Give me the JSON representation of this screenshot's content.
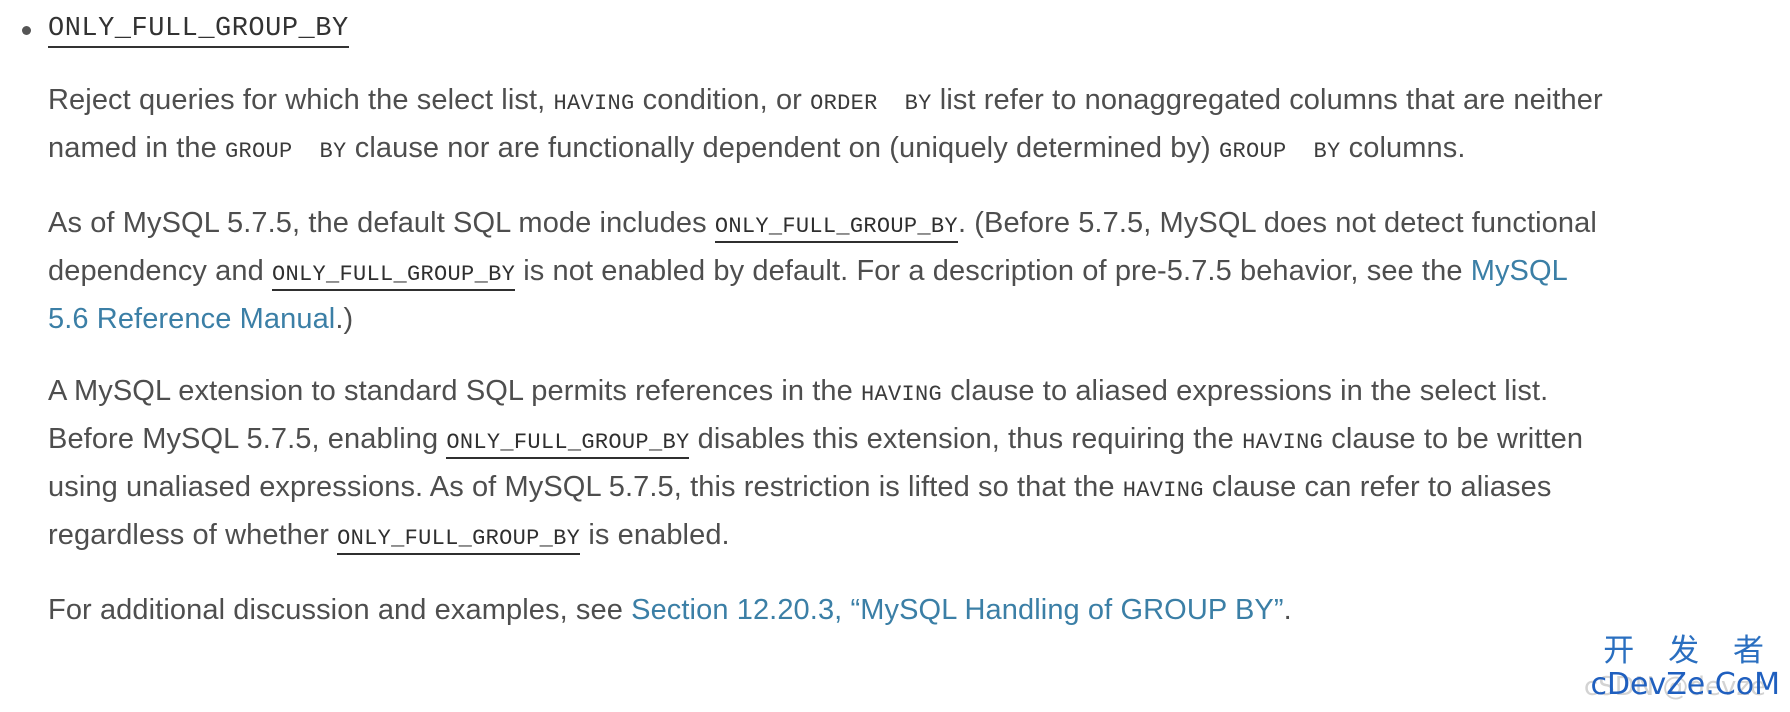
{
  "page": {
    "background_color": "#ffffff",
    "text_color": "#4e4e4e",
    "link_color": "#3b7fa6",
    "code_color": "#333333"
  },
  "heading": {
    "bullet_marker": "bullet-dot",
    "term": "ONLY_FULL_GROUP_BY"
  },
  "paragraphs": {
    "p1": {
      "s1": "Reject queries for which the select list, ",
      "code1": "HAVING",
      "s2": " condition, or ",
      "code2": "ORDER  BY",
      "s3": " list refer to nonaggregated columns that are neither named in the ",
      "code3": "GROUP  BY",
      "s4": " clause nor are functionally dependent on (uniquely determined by) ",
      "code4": "GROUP  BY",
      "s5": " columns."
    },
    "p2": {
      "s1": "As of MySQL 5.7.5, the default SQL mode includes ",
      "code1": "ONLY_FULL_GROUP_BY",
      "s2": ". (Before 5.7.5, MySQL does not detect functional dependency and ",
      "code2": "ONLY_FULL_GROUP_BY",
      "s3": " is not enabled by default. For a description of pre-5.7.5 behavior, see the ",
      "link1": "MySQL 5.6 Reference Manual",
      "s4": ".)"
    },
    "p3": {
      "s1": "A MySQL extension to standard SQL permits references in the ",
      "code1": "HAVING",
      "s2": " clause to aliased expressions in the select list. Before MySQL 5.7.5, enabling ",
      "code2": "ONLY_FULL_GROUP_BY",
      "s3": " disables this extension, thus requiring the ",
      "code3": "HAVING",
      "s4": " clause to be written using unaliased expressions. As of MySQL 5.7.5, this restriction is lifted so that the ",
      "code4": "HAVING",
      "s5": " clause can refer to aliases regardless of whether ",
      "code5": "ONLY_FULL_GROUP_BY",
      "s6": " is enabled."
    },
    "p4": {
      "s1": "For additional discussion and examples, see ",
      "link1": "Section 12.20.3, “MySQL Handling of GROUP BY”",
      "s2": "."
    }
  },
  "watermark": {
    "chinese": "开 发 者",
    "domain": "cDevZe.CoM",
    "ghost": "cSDN @devze",
    "color": "#2a6fc0"
  }
}
